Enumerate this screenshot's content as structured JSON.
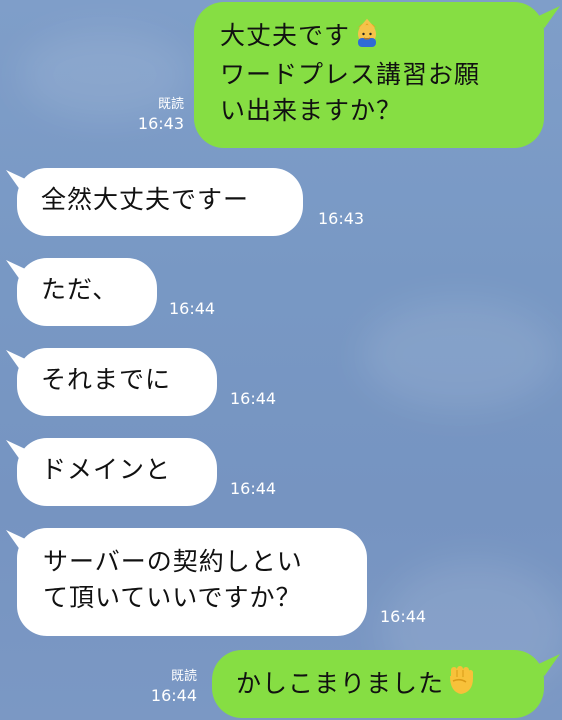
{
  "messages": [
    {
      "id": "m1",
      "side": "right",
      "lines": [
        "大丈夫です",
        "ワードプレス講習お願",
        "い出来ますか？"
      ],
      "emoji": "person-bowing-icon",
      "read": "既読",
      "time": "16:43"
    },
    {
      "id": "m2",
      "side": "left",
      "lines": [
        "全然大丈夫ですー"
      ],
      "time": "16:43"
    },
    {
      "id": "m3",
      "side": "left",
      "lines": [
        "ただ、"
      ],
      "time": "16:44"
    },
    {
      "id": "m4",
      "side": "left",
      "lines": [
        "それまでに"
      ],
      "time": "16:44"
    },
    {
      "id": "m5",
      "side": "left",
      "lines": [
        "ドメインと"
      ],
      "time": "16:44"
    },
    {
      "id": "m6",
      "side": "left",
      "lines": [
        "サーバーの契約しとい",
        "て頂いていいですか？"
      ],
      "time": "16:44"
    },
    {
      "id": "m7",
      "side": "right",
      "lines": [
        "かしこまりました"
      ],
      "emoji": "raised-fist-icon",
      "read": "既読",
      "time": "16:44"
    }
  ]
}
